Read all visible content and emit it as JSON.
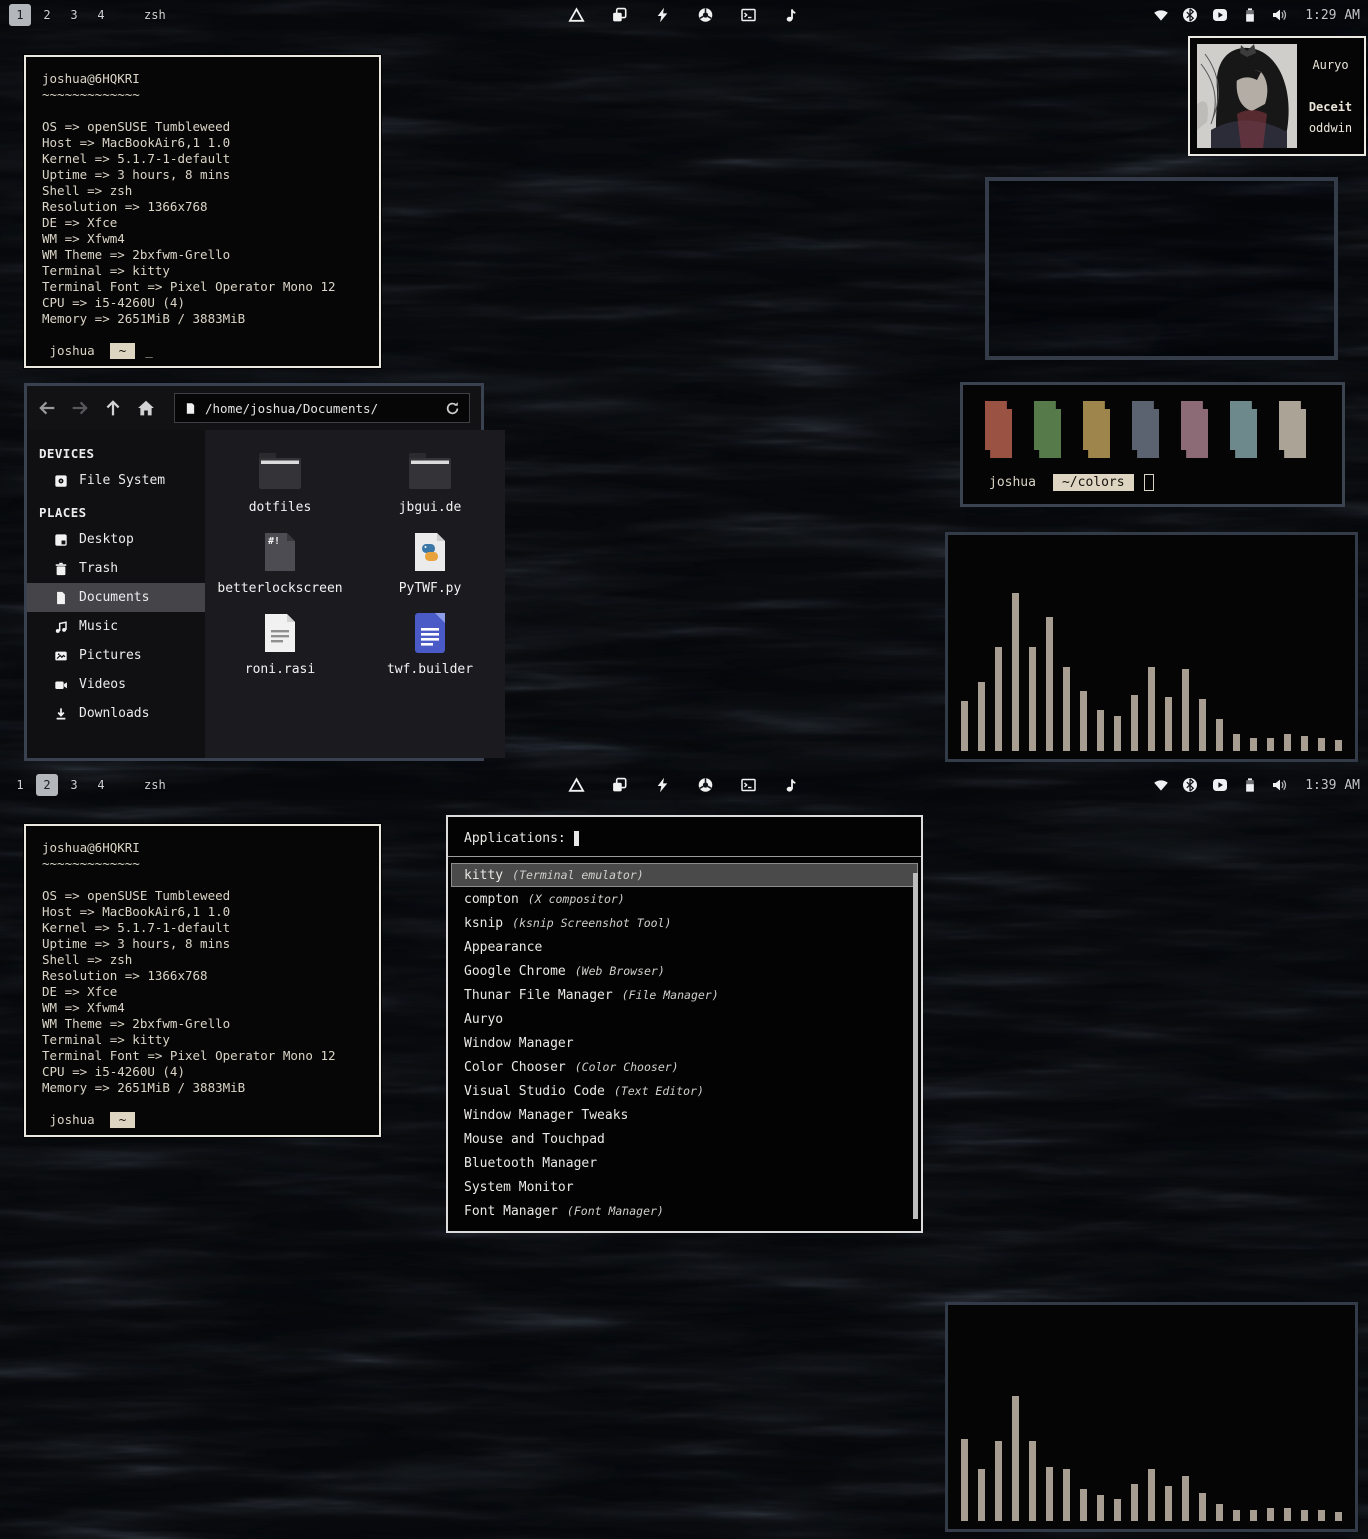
{
  "panel": {
    "workspaces": [
      "1",
      "2",
      "3",
      "4"
    ],
    "active_workspace_screen1": "1",
    "active_workspace_screen2": "2",
    "window_title": "zsh",
    "time_screen1": "1:29 AM",
    "time_screen2": "1:39 AM",
    "center_icons": [
      "triangle-icon",
      "copy-windows-icon",
      "bolt-icon",
      "chrome-icon",
      "terminal-icon",
      "music-note-icon"
    ],
    "tray_icons": [
      "wifi-icon",
      "bluetooth-icon",
      "media-player-icon",
      "battery-icon",
      "volume-icon"
    ]
  },
  "terminal": {
    "user_host": "joshua@6HQKRI",
    "underline": "~~~~~~~~~~~~~",
    "fetch_lines": [
      "OS => openSUSE Tumbleweed",
      "Host => MacBookAir6,1 1.0",
      "Kernel => 5.1.7-1-default",
      "Uptime => 3 hours, 8 mins",
      "Shell => zsh",
      "Resolution => 1366x768",
      "DE => Xfce",
      "WM => Xfwm4",
      "WM Theme => 2bxfwm-Grello",
      "Terminal => kitty",
      "Terminal Font => Pixel Operator Mono 12",
      "CPU => i5-4260U (4)",
      "Memory => 2651MiB / 3883MiB"
    ],
    "prompt_user": "joshua",
    "prompt_path": "~",
    "cursor": "_"
  },
  "player": {
    "app": "Auryo",
    "track": "Deceit",
    "artist": "oddwin"
  },
  "colors_terminal": {
    "user": "joshua",
    "path_block": "~/colors",
    "swatches": [
      "#9a5343",
      "#577a4b",
      "#9d854c",
      "#5b6370",
      "#8c6b77",
      "#6e898c",
      "#aba496"
    ]
  },
  "file_manager": {
    "path": "/home/joshua/Documents/",
    "devices_header": "DEVICES",
    "places_header": "PLACES",
    "devices": [
      {
        "label": "File System"
      }
    ],
    "places": [
      {
        "label": "Desktop"
      },
      {
        "label": "Trash"
      },
      {
        "label": "Documents",
        "selected": true
      },
      {
        "label": "Music"
      },
      {
        "label": "Pictures"
      },
      {
        "label": "Videos"
      },
      {
        "label": "Downloads"
      }
    ],
    "files": [
      {
        "name": "dotfiles",
        "icon": "folder"
      },
      {
        "name": "jbgui.de",
        "icon": "folder"
      },
      {
        "name": "betterlockscreen",
        "icon": "shell-script"
      },
      {
        "name": "PyTWF.py",
        "icon": "python-file"
      },
      {
        "name": "roni.rasi",
        "icon": "text-file"
      },
      {
        "name": "twf.builder",
        "icon": "builder-doc"
      }
    ]
  },
  "launcher": {
    "prompt": "Applications:",
    "items": [
      {
        "name": "kitty",
        "desc": "(Terminal emulator)",
        "selected": true
      },
      {
        "name": "compton",
        "desc": "(X compositor)"
      },
      {
        "name": "ksnip",
        "desc": "(ksnip Screenshot Tool)"
      },
      {
        "name": "Appearance",
        "desc": ""
      },
      {
        "name": "Google Chrome",
        "desc": "(Web Browser)"
      },
      {
        "name": "Thunar File Manager",
        "desc": "(File Manager)"
      },
      {
        "name": "Auryo",
        "desc": ""
      },
      {
        "name": "Window Manager",
        "desc": ""
      },
      {
        "name": "Color Chooser",
        "desc": "(Color Chooser)"
      },
      {
        "name": "Visual Studio Code",
        "desc": "(Text Editor)"
      },
      {
        "name": "Window Manager Tweaks",
        "desc": ""
      },
      {
        "name": "Mouse and Touchpad",
        "desc": ""
      },
      {
        "name": "Bluetooth Manager",
        "desc": ""
      },
      {
        "name": "System Monitor",
        "desc": ""
      },
      {
        "name": "Font Manager",
        "desc": "(Font Manager)"
      }
    ]
  },
  "visualizers": {
    "bar_color": "#a79e91",
    "screen1_bars": [
      23,
      32,
      48,
      73,
      48,
      62,
      39,
      28,
      19,
      16,
      26,
      39,
      25,
      38,
      24,
      15,
      8,
      6,
      6,
      8,
      7,
      6,
      5
    ],
    "screen2_bars": [
      38,
      24,
      37,
      58,
      37,
      25,
      24,
      15,
      12,
      10,
      17,
      24,
      16,
      21,
      13,
      8,
      5,
      5,
      6,
      6,
      5,
      5,
      4
    ]
  }
}
